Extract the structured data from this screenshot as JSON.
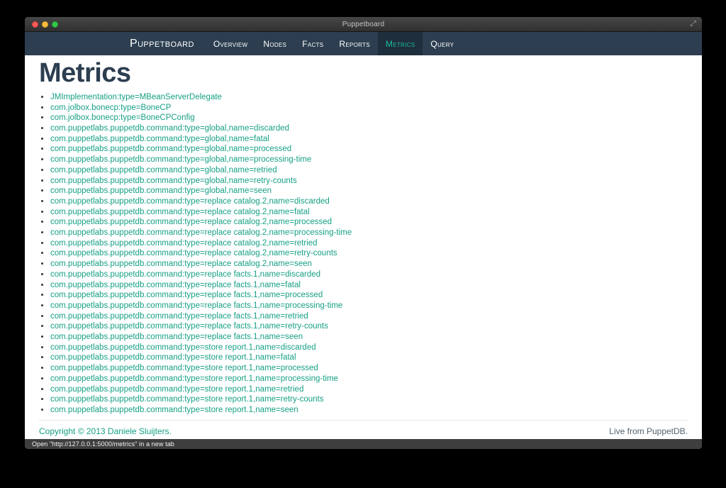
{
  "window": {
    "title": "Puppetboard"
  },
  "navbar": {
    "brand": "Puppetboard",
    "items": [
      {
        "label": "Overview",
        "active": false
      },
      {
        "label": "Nodes",
        "active": false
      },
      {
        "label": "Facts",
        "active": false
      },
      {
        "label": "Reports",
        "active": false
      },
      {
        "label": "Metrics",
        "active": true
      },
      {
        "label": "Query",
        "active": false
      }
    ]
  },
  "page": {
    "title": "Metrics",
    "metrics": [
      "JMImplementation:type=MBeanServerDelegate",
      "com.jolbox.bonecp:type=BoneCP",
      "com.jolbox.bonecp:type=BoneCPConfig",
      "com.puppetlabs.puppetdb.command:type=global,name=discarded",
      "com.puppetlabs.puppetdb.command:type=global,name=fatal",
      "com.puppetlabs.puppetdb.command:type=global,name=processed",
      "com.puppetlabs.puppetdb.command:type=global,name=processing-time",
      "com.puppetlabs.puppetdb.command:type=global,name=retried",
      "com.puppetlabs.puppetdb.command:type=global,name=retry-counts",
      "com.puppetlabs.puppetdb.command:type=global,name=seen",
      "com.puppetlabs.puppetdb.command:type=replace catalog.2,name=discarded",
      "com.puppetlabs.puppetdb.command:type=replace catalog.2,name=fatal",
      "com.puppetlabs.puppetdb.command:type=replace catalog.2,name=processed",
      "com.puppetlabs.puppetdb.command:type=replace catalog.2,name=processing-time",
      "com.puppetlabs.puppetdb.command:type=replace catalog.2,name=retried",
      "com.puppetlabs.puppetdb.command:type=replace catalog.2,name=retry-counts",
      "com.puppetlabs.puppetdb.command:type=replace catalog.2,name=seen",
      "com.puppetlabs.puppetdb.command:type=replace facts.1,name=discarded",
      "com.puppetlabs.puppetdb.command:type=replace facts.1,name=fatal",
      "com.puppetlabs.puppetdb.command:type=replace facts.1,name=processed",
      "com.puppetlabs.puppetdb.command:type=replace facts.1,name=processing-time",
      "com.puppetlabs.puppetdb.command:type=replace facts.1,name=retried",
      "com.puppetlabs.puppetdb.command:type=replace facts.1,name=retry-counts",
      "com.puppetlabs.puppetdb.command:type=replace facts.1,name=seen",
      "com.puppetlabs.puppetdb.command:type=store report.1,name=discarded",
      "com.puppetlabs.puppetdb.command:type=store report.1,name=fatal",
      "com.puppetlabs.puppetdb.command:type=store report.1,name=processed",
      "com.puppetlabs.puppetdb.command:type=store report.1,name=processing-time",
      "com.puppetlabs.puppetdb.command:type=store report.1,name=retried",
      "com.puppetlabs.puppetdb.command:type=store report.1,name=retry-counts",
      "com.puppetlabs.puppetdb.command:type=store report.1,name=seen"
    ]
  },
  "footer": {
    "copyright": "Copyright © 2013 Daniele Sluijters.",
    "live": "Live from PuppetDB."
  },
  "statusbar": {
    "text": "Open \"http://127.0.0.1:5000/metrics\" in a new tab"
  },
  "colors": {
    "navbar_bg": "#2c3e50",
    "navbar_active_bg": "#1f2e3d",
    "nav_active_text": "#18bc9c",
    "link": "#16a085",
    "heading": "#2c3e50",
    "statusbar_bg": "#3e3e3e"
  }
}
